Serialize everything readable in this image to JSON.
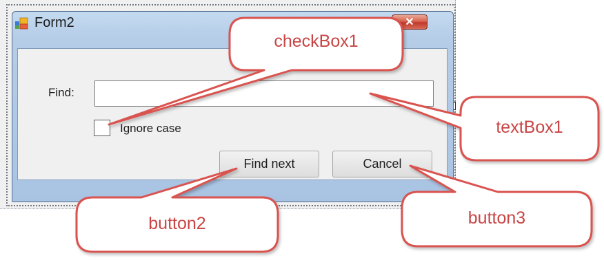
{
  "form": {
    "title": "Form2",
    "close_glyph": "✕",
    "find_label": "Find:",
    "textbox_value": "",
    "checkbox_label": "Ignore case",
    "checkbox_checked": false,
    "find_next_label": "Find next",
    "cancel_label": "Cancel"
  },
  "callouts": {
    "checkbox": "checkBox1",
    "textbox": "textBox1",
    "find_next": "button2",
    "cancel": "button3"
  },
  "colors": {
    "callout_border": "#d9534f",
    "callout_text": "#c94545",
    "titlebar": "#b6cde8"
  },
  "icons": {
    "form_icon": "windows-form-icon",
    "close": "close-icon"
  }
}
